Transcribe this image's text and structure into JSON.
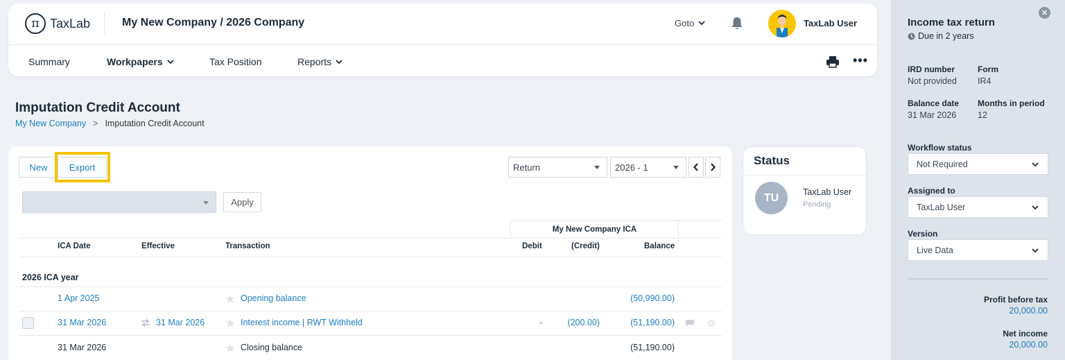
{
  "header": {
    "logo_symbol": "π",
    "logo_text": "TaxLab",
    "company_title": "My New Company / 2026 Company",
    "goto_label": "Goto",
    "user_name": "TaxLab User"
  },
  "nav": {
    "items": [
      {
        "label": "Summary"
      },
      {
        "label": "Workpapers"
      },
      {
        "label": "Tax Position"
      },
      {
        "label": "Reports"
      }
    ],
    "more_label": "•••"
  },
  "page": {
    "title": "Imputation Credit Account",
    "breadcrumb": [
      "My New Company",
      ">",
      "Imputation Credit Account"
    ]
  },
  "toolbar": {
    "new_label": "New",
    "export_label": "Export",
    "return_select": "Return",
    "period_select": "2026 - 1",
    "prev_label": "‹",
    "next_label": "›",
    "apply_label": "Apply",
    "highlight_color": "#f5c400"
  },
  "table": {
    "group_header": "My New Company ICA",
    "columns": [
      "ICA Date",
      "Effective",
      "Transaction",
      "Debit",
      "(Credit)",
      "Balance"
    ],
    "year_label": "2026 ICA year",
    "rows": [
      {
        "ica_date": "1 Apr 2025",
        "effective": "",
        "transaction": "Opening balance",
        "debit": "",
        "credit": "",
        "balance": "(50,990.00)"
      },
      {
        "ica_date": "31 Mar 2026",
        "effective": "31 Mar 2026",
        "transaction": "Interest income | RWT Withheld",
        "debit": "-",
        "credit": "(200.00)",
        "balance": "(51,190.00)"
      },
      {
        "ica_date": "31 Mar 2026",
        "effective": "",
        "transaction": "Closing balance",
        "debit": "",
        "credit": "",
        "balance": "(51,190.00)"
      }
    ]
  },
  "status": {
    "title": "Status",
    "initials": "TU",
    "user": "TaxLab User",
    "state": "Pending"
  },
  "sidebar": {
    "close_label": "✕",
    "title": "Income tax return",
    "due": "Due in 2 years",
    "ird_label": "IRD number",
    "ird_value": "Not provided",
    "form_label": "Form",
    "form_value": "IR4",
    "balance_date_label": "Balance date",
    "balance_date_value": "31 Mar 2026",
    "months_label": "Months in period",
    "months_value": "12",
    "workflow_label": "Workflow status",
    "workflow_value": "Not Required",
    "assigned_label": "Assigned to",
    "assigned_value": "TaxLab User",
    "version_label": "Version",
    "version_value": "Live Data",
    "profit_label": "Profit before tax",
    "profit_value": "20,000.00",
    "net_income_label": "Net income",
    "net_income_value": "20,000.00"
  },
  "colors": {
    "accent": "#1b7fc1",
    "text": "#1c2b39",
    "avatar_bg": "#f7c600",
    "sidebar_bg": "#dde3ea"
  }
}
